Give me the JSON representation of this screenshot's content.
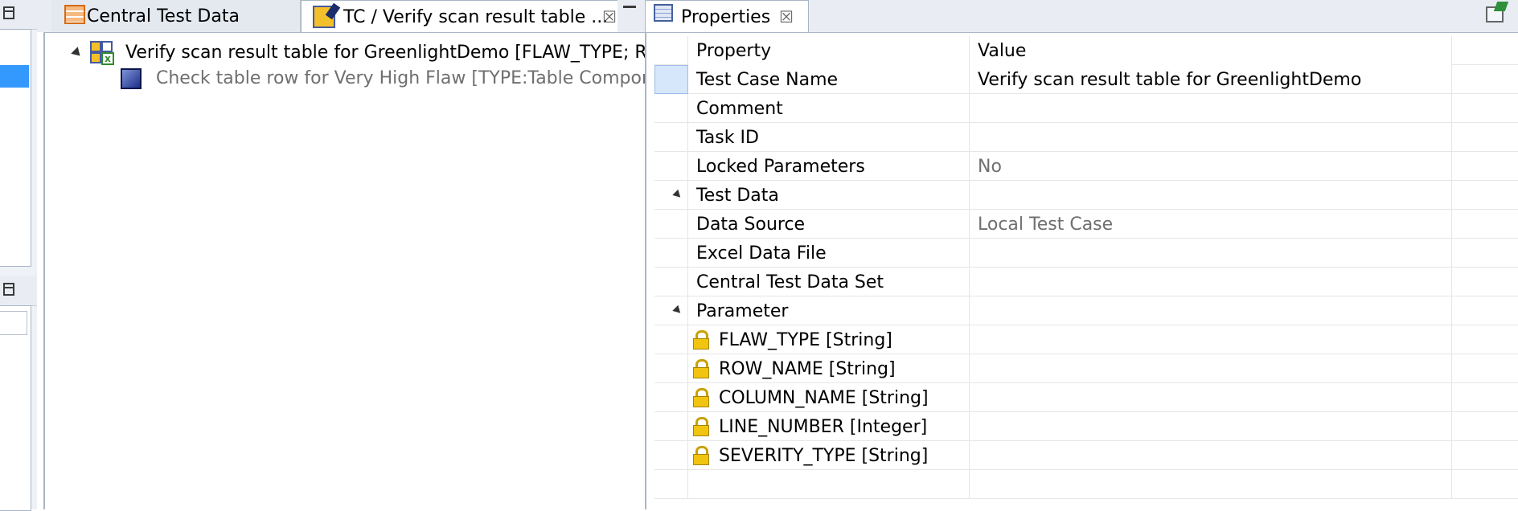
{
  "editor": {
    "tabs": [
      {
        "label": "Central Test Data",
        "icon": "table-icon"
      },
      {
        "label": "TC / Verify scan result table ...",
        "icon": "test-case-editor-icon"
      }
    ],
    "close_glyph": "☒",
    "tree": {
      "root": "Verify scan result table for GreenlightDemo [FLAW_TYPE; ROW",
      "child": "Check table row for Very High Flaw [TYPE:Table Compon"
    }
  },
  "properties": {
    "tab_label": "Properties",
    "close_glyph": "☒",
    "header": {
      "property": "Property",
      "value": "Value"
    },
    "rows": [
      {
        "property": "Test Case Name",
        "value": "Verify scan result table for GreenlightDemo"
      },
      {
        "property": "Comment",
        "value": ""
      },
      {
        "property": "Task ID",
        "value": ""
      },
      {
        "property": "Locked Parameters",
        "value": "No"
      },
      {
        "property": "Test Data",
        "value": ""
      },
      {
        "property": "Data Source",
        "value": "Local Test Case"
      },
      {
        "property": "Excel Data File",
        "value": ""
      },
      {
        "property": "Central Test Data Set",
        "value": ""
      },
      {
        "property": "Parameter",
        "value": ""
      },
      {
        "property": "FLAW_TYPE [String]",
        "value": ""
      },
      {
        "property": "ROW_NAME [String]",
        "value": ""
      },
      {
        "property": "COLUMN_NAME [String]",
        "value": ""
      },
      {
        "property": "LINE_NUMBER [Integer]",
        "value": ""
      },
      {
        "property": "SEVERITY_TYPE [String]",
        "value": ""
      }
    ]
  },
  "colors": {
    "selection": "#3399ff",
    "panel_border": "#a9b6c6",
    "gray_text": "#6f6f6f"
  }
}
